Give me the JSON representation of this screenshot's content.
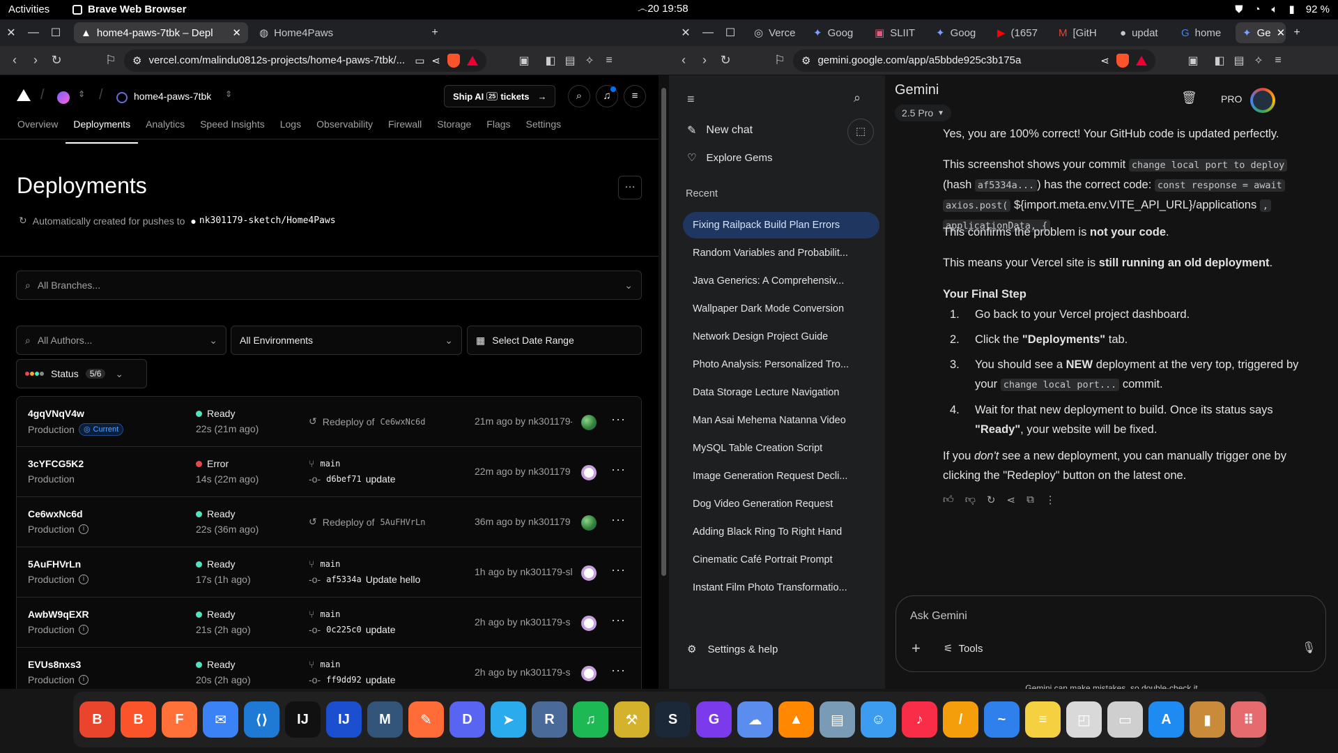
{
  "topbar": {
    "activities": "Activities",
    "app_name": "Brave Web Browser",
    "clock": "෴20  19:58",
    "battery": "92 %"
  },
  "left_browser": {
    "tabs": [
      {
        "title": "home4-paws-7tbk – Depl"
      },
      {
        "title": "Home4Paws"
      }
    ],
    "url": "vercel.com/malindu0812s-projects/home4-paws-7tbk/..."
  },
  "vercel": {
    "project": "home4-paws-7tbk",
    "ship_label": "Ship AI",
    "ship_count": "25",
    "ship_suffix": "tickets",
    "nav": [
      "Overview",
      "Deployments",
      "Analytics",
      "Speed Insights",
      "Logs",
      "Observability",
      "Firewall",
      "Storage",
      "Flags",
      "Settings"
    ],
    "page_title": "Deployments",
    "subtitle": "Automatically created for pushes to",
    "repo": "nk301179-sketch/Home4Paws",
    "filters": {
      "branches": "All Branches...",
      "authors": "All Authors...",
      "environments": "All Environments",
      "date": "Select Date Range",
      "status": "Status",
      "status_count": "5/6"
    },
    "deployments": [
      {
        "id": "4gqVNqV4w",
        "env": "Production",
        "badge": "Current",
        "status": "Ready",
        "status_color": "#50e3c2",
        "duration": "22s (21m ago)",
        "src_type": "redeploy",
        "src_label": "Redeploy of",
        "src_ref": "Ce6wxNc6d",
        "when": "21m ago by nk301179-",
        "avatar": "#4caf50"
      },
      {
        "id": "3cYFCG5K2",
        "env": "Production",
        "status": "Error",
        "status_color": "#e5484d",
        "duration": "14s (22m ago)",
        "src_type": "commit",
        "branch": "main",
        "commit": "d6bef71",
        "message": "update",
        "when": "22m ago by nk301179",
        "avatar": "#c8a0e0"
      },
      {
        "id": "Ce6wxNc6d",
        "env": "Production",
        "status": "Ready",
        "status_color": "#50e3c2",
        "duration": "22s (36m ago)",
        "src_type": "redeploy",
        "src_label": "Redeploy of",
        "src_ref": "5AuFHVrLn",
        "when": "36m ago by nk301179",
        "avatar": "#4caf50"
      },
      {
        "id": "5AuFHVrLn",
        "env": "Production",
        "status": "Ready",
        "status_color": "#50e3c2",
        "duration": "17s (1h ago)",
        "src_type": "commit",
        "branch": "main",
        "commit": "af5334a",
        "message": "Update hello",
        "when": "1h ago by nk301179-sl",
        "avatar": "#c8a0e0"
      },
      {
        "id": "AwbW9qEXR",
        "env": "Production",
        "status": "Ready",
        "status_color": "#50e3c2",
        "duration": "21s (2h ago)",
        "src_type": "commit",
        "branch": "main",
        "commit": "0c225c0",
        "message": "update",
        "when": "2h ago by nk301179-s",
        "avatar": "#c8a0e0"
      },
      {
        "id": "EVUs8nxs3",
        "env": "Production",
        "status": "Ready",
        "status_color": "#50e3c2",
        "duration": "20s (2h ago)",
        "src_type": "commit",
        "branch": "main",
        "commit": "ff9dd92",
        "message": "update",
        "when": "2h ago by nk301179-s",
        "avatar": "#c8a0e0"
      }
    ]
  },
  "right_browser": {
    "tabs": [
      "Verce",
      "Goog",
      "SLIIT",
      "Goog",
      "(1657",
      "[GitH",
      "updat",
      "home",
      "Ge"
    ],
    "url": "gemini.google.com/app/a5bbde925c3b175a"
  },
  "gemini": {
    "title": "Gemini",
    "model": "2.5 Pro",
    "pro_badge": "PRO",
    "new_chat": "New chat",
    "explore_gems": "Explore Gems",
    "recent_label": "Recent",
    "recent": [
      "Fixing Railpack Build Plan Errors",
      "Random Variables and Probabilit...",
      "Java Generics: A Comprehensiv...",
      "Wallpaper Dark Mode Conversion",
      "Network Design Project Guide",
      "Photo Analysis: Personalized Tro...",
      "Data Storage Lecture Navigation",
      "Man Asai Mehema Natanna Video",
      "MySQL Table Creation Script",
      "Image Generation Request Decli...",
      "Dog Video Generation Request",
      "Adding Black Ring To Right Hand",
      "Cinematic Café Portrait Prompt",
      "Instant Film Photo Transformatio..."
    ],
    "settings_help": "Settings & help",
    "response": {
      "p1": "Yes, you are 100% correct! Your GitHub code is updated perfectly.",
      "p2_a": "This screenshot shows your commit",
      "p2_code1": "change local port to deploy",
      "p2_b": "(hash",
      "p2_code2": "af5334a...",
      "p2_c": ") has the correct code:",
      "p2_code3": "const response = await",
      "p2_code4": "axios.post(",
      "p2_d": "${import.meta.env.VITE_API_URL}/applications",
      "p2_code5": ",",
      "p2_code6": "applicationData, {",
      "p3_a": "This confirms the problem is",
      "p3_b": "not your code",
      "p3_c": ".",
      "p4_a": "This means your Vercel site is",
      "p4_b": "still running an old deployment",
      "p4_c": ".",
      "heading": "Your Final Step",
      "s1": "Go back to your Vercel project dashboard.",
      "s2_a": "Click the",
      "s2_b": "\"Deployments\"",
      "s2_c": "tab.",
      "s3_a": "You should see a",
      "s3_b": "NEW",
      "s3_c": "deployment at the very top, triggered by your",
      "s3_code": "change local port...",
      "s3_d": "commit.",
      "s4_a": "Wait for that new deployment to build. Once its status says",
      "s4_b": "\"Ready\"",
      "s4_c": ",",
      "s4_d": "your website will be fixed.",
      "p5_a": "If you",
      "p5_b": "don't",
      "p5_c": "see a new deployment, you can manually trigger one by",
      "p5_d": "clicking the \"Redeploy\" button on the latest one."
    },
    "input_placeholder": "Ask Gemini",
    "tools": "Tools",
    "disclaimer": "Gemini can make mistakes, so double-check it"
  },
  "dock": {
    "apps": [
      {
        "name": "brave-browser-dock-icon",
        "color": "#e8452c",
        "glyph": "B"
      },
      {
        "name": "brave-icon",
        "color": "#fb542b",
        "glyph": "B"
      },
      {
        "name": "firefox-icon",
        "color": "#ff7139",
        "glyph": "F"
      },
      {
        "name": "mail-icon",
        "color": "#3b82f6",
        "glyph": "✉"
      },
      {
        "name": "vscode-icon",
        "color": "#1f7ad6",
        "glyph": "⟨⟩"
      },
      {
        "name": "intellij-icon",
        "color": "#111111",
        "glyph": "IJ"
      },
      {
        "name": "intellij-ce-icon",
        "color": "#1c4fcf",
        "glyph": "IJ"
      },
      {
        "name": "mysql-workbench-icon",
        "color": "#33557a",
        "glyph": "M"
      },
      {
        "name": "postman-icon",
        "color": "#ff6c37",
        "glyph": "✎"
      },
      {
        "name": "discord-icon",
        "color": "#5865f2",
        "glyph": "D"
      },
      {
        "name": "telegram-icon",
        "color": "#2aabee",
        "glyph": "➤"
      },
      {
        "name": "r-icon",
        "color": "#4a6b9a",
        "glyph": "R"
      },
      {
        "name": "spotify-icon",
        "color": "#1db954",
        "glyph": "♫"
      },
      {
        "name": "tool-icon",
        "color": "#d4b22c",
        "glyph": "⚒"
      },
      {
        "name": "steam-icon",
        "color": "#1b2838",
        "glyph": "S"
      },
      {
        "name": "github-desktop-icon",
        "color": "#7c3aed",
        "glyph": "G"
      },
      {
        "name": "cloud-icon",
        "color": "#5b8def",
        "glyph": "☁"
      },
      {
        "name": "vlc-icon",
        "color": "#ff8800",
        "glyph": "▲"
      },
      {
        "name": "scanner-icon",
        "color": "#7a9bb5",
        "glyph": "▤"
      },
      {
        "name": "finder-icon",
        "color": "#3b9cf0",
        "glyph": "☺"
      },
      {
        "name": "music-icon",
        "color": "#fa2d48",
        "glyph": "♪"
      },
      {
        "name": "pages-icon",
        "color": "#f59e0b",
        "glyph": "/"
      },
      {
        "name": "freeform-icon",
        "color": "#2f80ed",
        "glyph": "~"
      },
      {
        "name": "notes-icon",
        "color": "#f5d142",
        "glyph": "≡"
      },
      {
        "name": "preview-icon",
        "color": "#d9d9d9",
        "glyph": "◰"
      },
      {
        "name": "terminal-icon",
        "color": "#cfcfcf",
        "glyph": "▭"
      },
      {
        "name": "app-store-icon",
        "color": "#1d8bf1",
        "glyph": "A"
      },
      {
        "name": "trash-icon",
        "color": "#c98a3a",
        "glyph": "▮"
      },
      {
        "name": "app-grid-icon",
        "color": "#e56b6f",
        "glyph": "⠿"
      }
    ]
  }
}
